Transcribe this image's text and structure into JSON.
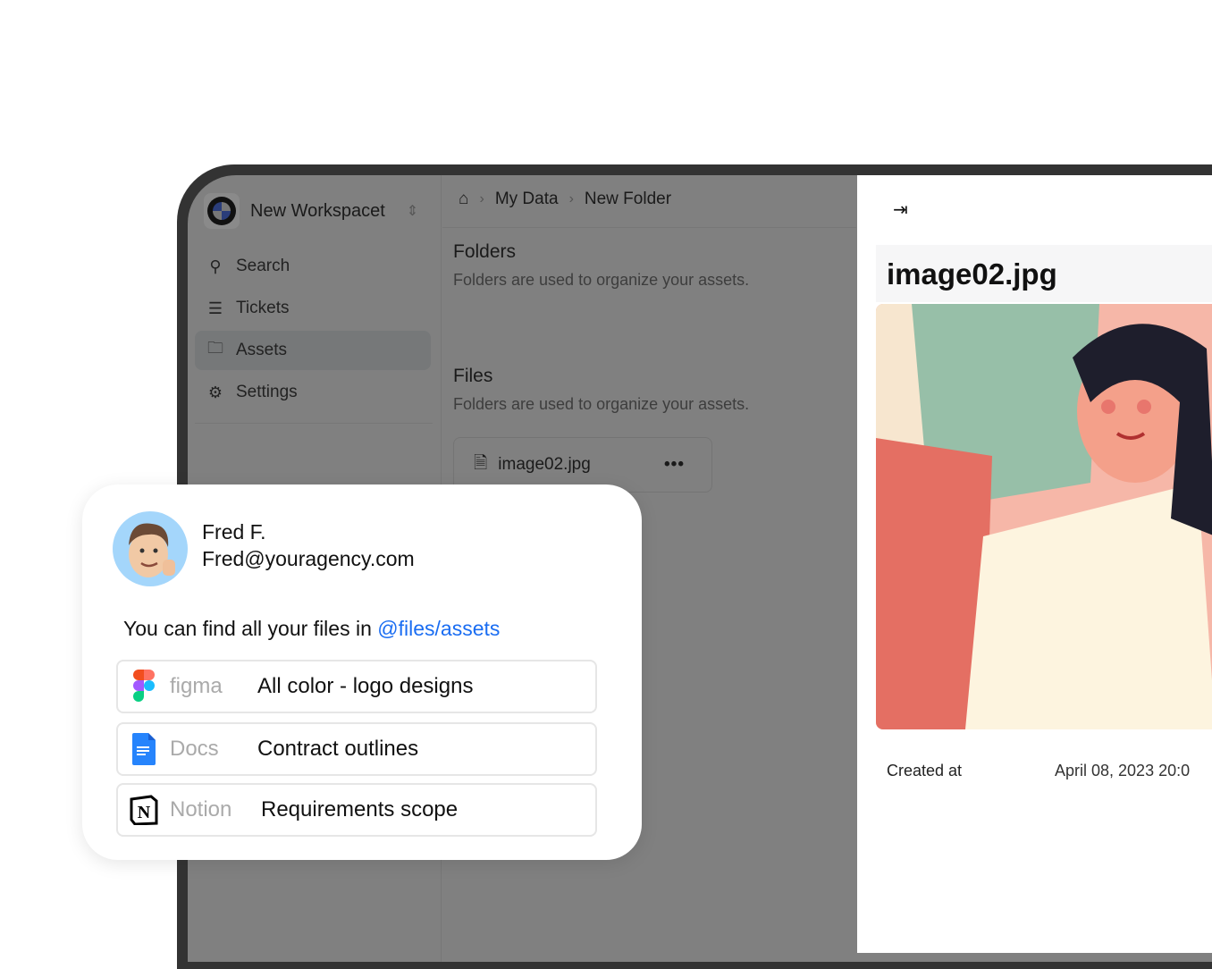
{
  "workspace": {
    "name": "New Workspacet"
  },
  "sidebar": {
    "items": [
      {
        "label": "Search",
        "icon": "search-icon"
      },
      {
        "label": "Tickets",
        "icon": "list-icon"
      },
      {
        "label": "Assets",
        "icon": "folder-icon",
        "active": true
      },
      {
        "label": "Settings",
        "icon": "gear-icon"
      }
    ]
  },
  "breadcrumb": [
    "My Data",
    "New Folder"
  ],
  "main": {
    "folders": {
      "title": "Folders",
      "desc": "Folders are used to organize your assets."
    },
    "files": {
      "title": "Files",
      "desc": "Folders are used to organize your assets."
    },
    "file": {
      "name": "image02.jpg"
    }
  },
  "panel": {
    "title": "image02.jpg",
    "created_label": "Created at",
    "created_value": "April 08, 2023 20:0"
  },
  "card": {
    "name": "Fred F.",
    "email": "Fred@youragency.com",
    "message": "You can find all your files in ",
    "link": "@files/assets",
    "rows": [
      {
        "app": "figma",
        "title": "All color - logo designs"
      },
      {
        "app": "Docs",
        "title": "Contract outlines"
      },
      {
        "app": "Notion",
        "title": "Requirements scope"
      }
    ]
  },
  "colors": {
    "link": "#1a6df2",
    "overlay": "#808080"
  }
}
